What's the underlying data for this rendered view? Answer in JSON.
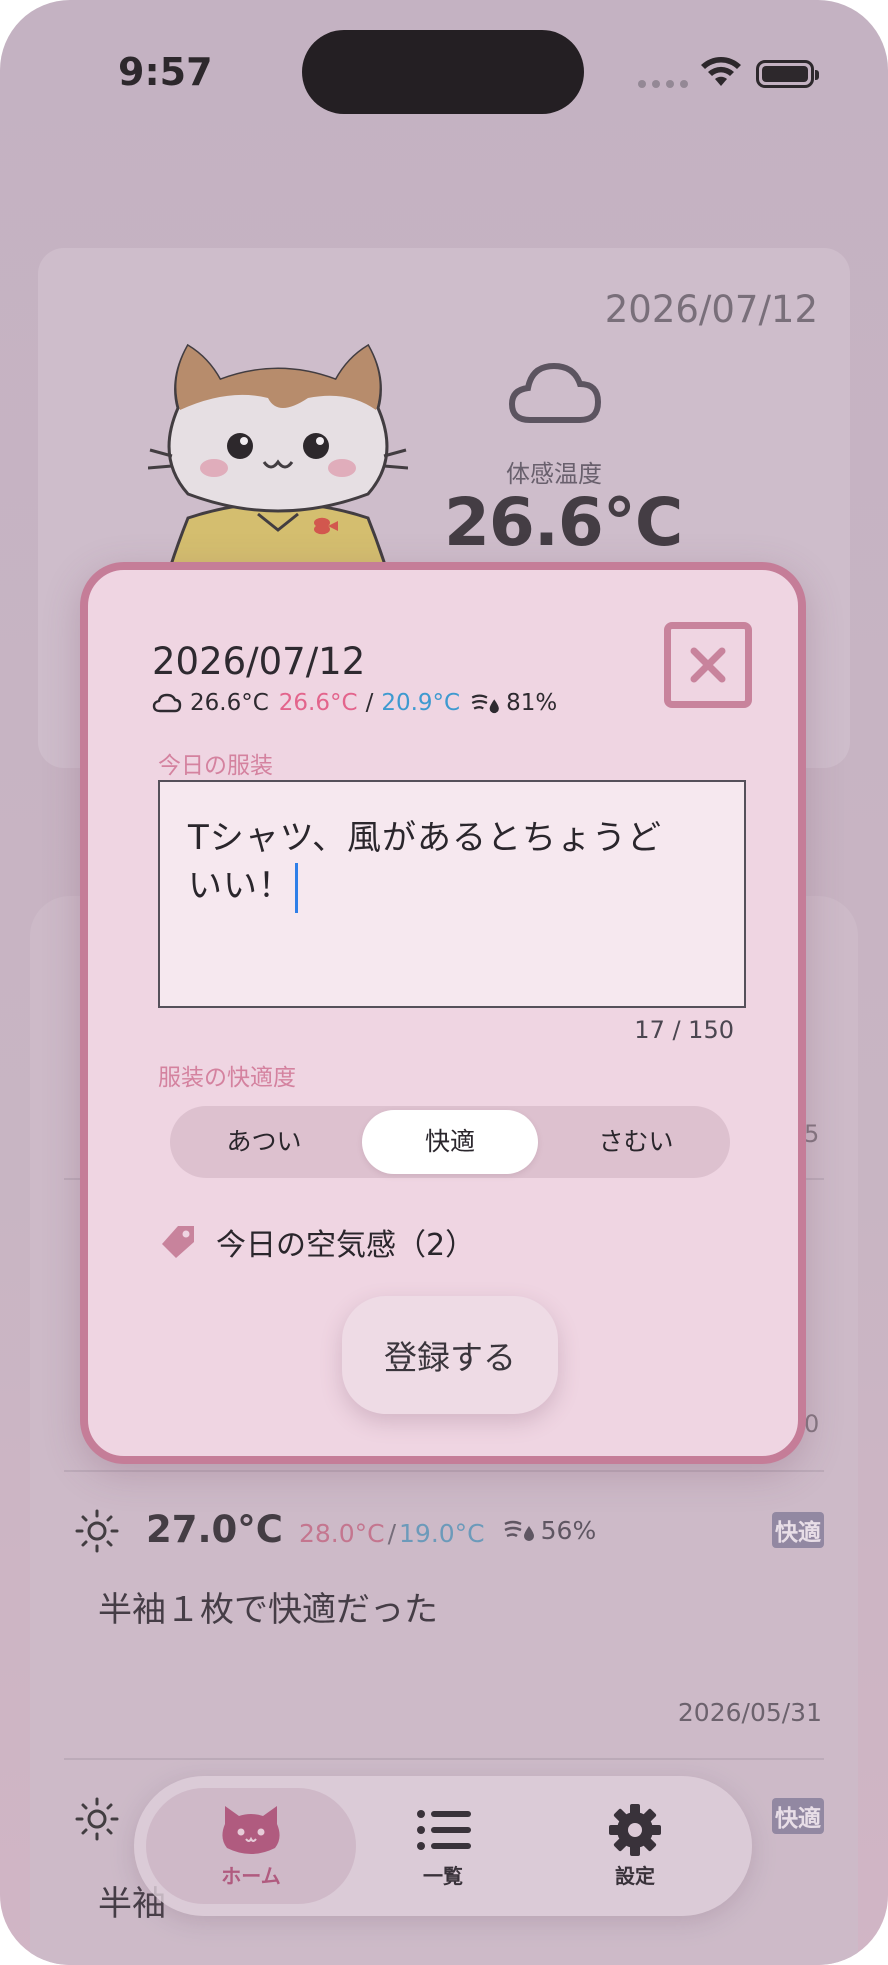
{
  "status_bar": {
    "time": "9:57"
  },
  "weather_card": {
    "date": "2026/07/12",
    "feels_like_label": "体感温度",
    "feels_like_value": "26.6°C"
  },
  "list": {
    "peek_1": "5",
    "peek_2": "0",
    "entries": [
      {
        "temp": "27.0°C",
        "high": "28.0°C",
        "low": "19.0°C",
        "humidity": "56%",
        "badge": "快適",
        "note": "半袖１枚で快適だった",
        "date": "2026/05/31"
      },
      {
        "badge": "快適",
        "note": "半袖"
      }
    ]
  },
  "modal": {
    "date": "2026/07/12",
    "weather": {
      "feels": "26.6°C",
      "high": "26.6°C",
      "separator": "/",
      "low": "20.9°C",
      "humidity": "81%"
    },
    "outfit_label": "今日の服装",
    "outfit_text_line1": "Tシャツ、風があるとちょうど",
    "outfit_text_line2": "いい！",
    "char_count": "17 / 150",
    "comfort_label": "服装の快適度",
    "comfort_options": [
      "あつい",
      "快適",
      "さむい"
    ],
    "comfort_selected": "快適",
    "air_tags_label": "今日の空気感（2）",
    "submit_label": "登録する"
  },
  "tabbar": {
    "tabs": [
      {
        "label": "ホーム",
        "icon": "cat-home-icon",
        "active": true
      },
      {
        "label": "一覧",
        "icon": "list-icon",
        "active": false
      },
      {
        "label": "設定",
        "icon": "gear-icon",
        "active": false
      }
    ]
  },
  "colors": {
    "accent": "#c57d98",
    "high_temp": "#e3648c",
    "low_temp": "#3e9ad0",
    "caret": "#2f7fe8"
  }
}
